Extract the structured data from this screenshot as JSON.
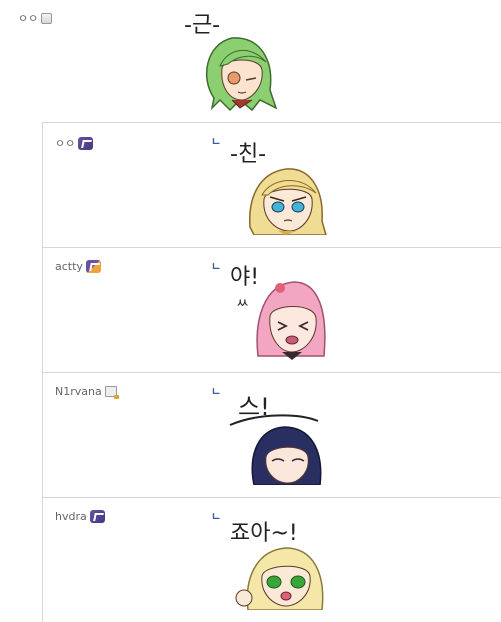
{
  "post": {
    "author": "ㅇㅇ",
    "sticker": {
      "text": "-근-",
      "hair": "#8ccf71",
      "eye": "#e89b6a"
    }
  },
  "replies": [
    {
      "author": "ㅇㅇ",
      "badge": "purple-badge",
      "arrow": "ㄴ",
      "sticker": {
        "text": "-친-",
        "hair": "#f0dc93",
        "eye": "#43b4d6"
      }
    },
    {
      "author": "actty",
      "badge": "orange-badge",
      "arrow": "ㄴ",
      "sticker": {
        "text": "야!",
        "hair": "#f2a6c2",
        "eye": "#c85c7a"
      }
    },
    {
      "author": "N1rvana",
      "badge": "lock-badge",
      "arrow": "ㄴ",
      "sticker": {
        "text": "스!",
        "hair": "#2a2f62",
        "eye": "#7a4a7a"
      }
    },
    {
      "author": "hvdra",
      "badge": "purple-badge",
      "arrow": "ㄴ",
      "sticker": {
        "text": "죠아~!",
        "hair": "#f4e7a8",
        "eye": "#3aa63a"
      }
    }
  ]
}
